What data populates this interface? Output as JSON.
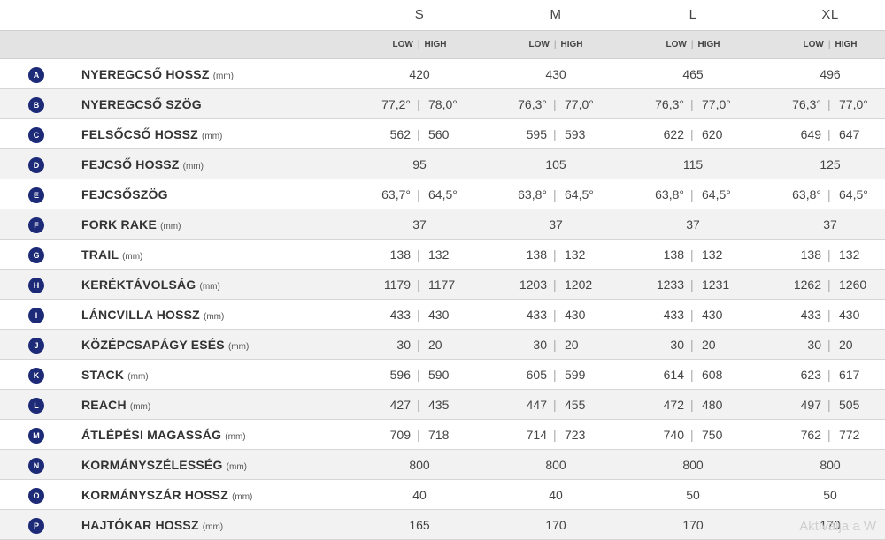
{
  "sizes": [
    "S",
    "M",
    "L",
    "XL"
  ],
  "sub_header": {
    "low": "LOW",
    "separator": "|",
    "high": "HIGH"
  },
  "rows": [
    {
      "badge": "A",
      "name": "NYEREGCSŐ HOSSZ",
      "unit": "(mm)",
      "values": [
        [
          "420"
        ],
        [
          "430"
        ],
        [
          "465"
        ],
        [
          "496"
        ]
      ]
    },
    {
      "badge": "B",
      "name": "NYEREGCSŐ SZÖG",
      "unit": "",
      "values": [
        [
          "77,2°",
          "78,0°"
        ],
        [
          "76,3°",
          "77,0°"
        ],
        [
          "76,3°",
          "77,0°"
        ],
        [
          "76,3°",
          "77,0°"
        ]
      ]
    },
    {
      "badge": "C",
      "name": "FELSŐCSŐ HOSSZ",
      "unit": "(mm)",
      "values": [
        [
          "562",
          "560"
        ],
        [
          "595",
          "593"
        ],
        [
          "622",
          "620"
        ],
        [
          "649",
          "647"
        ]
      ]
    },
    {
      "badge": "D",
      "name": "FEJCSŐ HOSSZ",
      "unit": "(mm)",
      "values": [
        [
          "95"
        ],
        [
          "105"
        ],
        [
          "115"
        ],
        [
          "125"
        ]
      ]
    },
    {
      "badge": "E",
      "name": "FEJCSŐSZÖG",
      "unit": "",
      "values": [
        [
          "63,7°",
          "64,5°"
        ],
        [
          "63,8°",
          "64,5°"
        ],
        [
          "63,8°",
          "64,5°"
        ],
        [
          "63,8°",
          "64,5°"
        ]
      ]
    },
    {
      "badge": "F",
      "name": "FORK RAKE",
      "unit": "(mm)",
      "values": [
        [
          "37"
        ],
        [
          "37"
        ],
        [
          "37"
        ],
        [
          "37"
        ]
      ]
    },
    {
      "badge": "G",
      "name": "TRAIL",
      "unit": "(mm)",
      "values": [
        [
          "138",
          "132"
        ],
        [
          "138",
          "132"
        ],
        [
          "138",
          "132"
        ],
        [
          "138",
          "132"
        ]
      ]
    },
    {
      "badge": "H",
      "name": "KERÉKTÁVOLSÁG",
      "unit": "(mm)",
      "values": [
        [
          "1179",
          "1177"
        ],
        [
          "1203",
          "1202"
        ],
        [
          "1233",
          "1231"
        ],
        [
          "1262",
          "1260"
        ]
      ]
    },
    {
      "badge": "I",
      "name": "LÁNCVILLA HOSSZ",
      "unit": "(mm)",
      "values": [
        [
          "433",
          "430"
        ],
        [
          "433",
          "430"
        ],
        [
          "433",
          "430"
        ],
        [
          "433",
          "430"
        ]
      ]
    },
    {
      "badge": "J",
      "name": "KÖZÉPCSAPÁGY ESÉS",
      "unit": "(mm)",
      "values": [
        [
          "30",
          "20"
        ],
        [
          "30",
          "20"
        ],
        [
          "30",
          "20"
        ],
        [
          "30",
          "20"
        ]
      ]
    },
    {
      "badge": "K",
      "name": "STACK",
      "unit": "(mm)",
      "values": [
        [
          "596",
          "590"
        ],
        [
          "605",
          "599"
        ],
        [
          "614",
          "608"
        ],
        [
          "623",
          "617"
        ]
      ]
    },
    {
      "badge": "L",
      "name": "REACH",
      "unit": "(mm)",
      "values": [
        [
          "427",
          "435"
        ],
        [
          "447",
          "455"
        ],
        [
          "472",
          "480"
        ],
        [
          "497",
          "505"
        ]
      ]
    },
    {
      "badge": "M",
      "name": "ÁTLÉPÉSI MAGASSÁG",
      "unit": "(mm)",
      "values": [
        [
          "709",
          "718"
        ],
        [
          "714",
          "723"
        ],
        [
          "740",
          "750"
        ],
        [
          "762",
          "772"
        ]
      ]
    },
    {
      "badge": "N",
      "name": "KORMÁNYSZÉLESSÉG",
      "unit": "(mm)",
      "values": [
        [
          "800"
        ],
        [
          "800"
        ],
        [
          "800"
        ],
        [
          "800"
        ]
      ]
    },
    {
      "badge": "O",
      "name": "KORMÁNYSZÁR HOSSZ",
      "unit": "(mm)",
      "values": [
        [
          "40"
        ],
        [
          "40"
        ],
        [
          "50"
        ],
        [
          "50"
        ]
      ]
    },
    {
      "badge": "P",
      "name": "HAJTÓKAR HOSSZ",
      "unit": "(mm)",
      "values": [
        [
          "165"
        ],
        [
          "170"
        ],
        [
          "170"
        ],
        [
          "170"
        ]
      ]
    }
  ],
  "watermark": "Aktiválja a W"
}
